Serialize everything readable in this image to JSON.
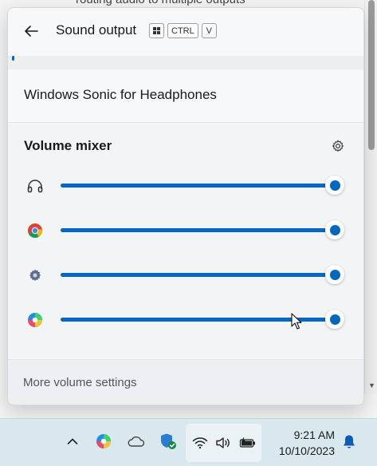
{
  "background": {
    "text": "routing audio to multiple outputs"
  },
  "flyout": {
    "title": "Sound output",
    "shortcut_keys": [
      "CTRL",
      "V"
    ],
    "spatial_sound": "Windows Sonic for Headphones",
    "mixer": {
      "title": "Volume mixer",
      "rows": [
        {
          "app": "headphones-icon",
          "volume": 100
        },
        {
          "app": "chrome-icon",
          "volume": 100
        },
        {
          "app": "settings-app-icon",
          "volume": 100
        },
        {
          "app": "edge-dev-icon",
          "volume": 100
        }
      ]
    },
    "footer_link": "More volume settings"
  },
  "taskbar": {
    "time": "9:21 AM",
    "date": "10/10/2023",
    "tray_icons": [
      "chevron-up-icon",
      "edge-dev-icon",
      "onedrive-icon",
      "defender-icon",
      "wifi-icon",
      "speaker-icon",
      "battery-icon",
      "notification-bell-icon"
    ]
  },
  "colors": {
    "accent": "#0067c0",
    "taskbar": "#d9e8ee"
  }
}
